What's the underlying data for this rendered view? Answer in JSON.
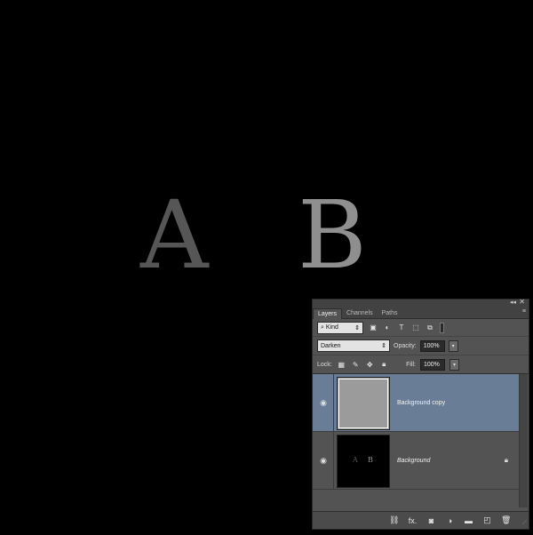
{
  "canvas": {
    "letter_a": "A",
    "letter_b": "B",
    "letter_a_color": "#565656",
    "letter_b_color": "#8f8f8f"
  },
  "panel": {
    "tabs": [
      "Layers",
      "Channels",
      "Paths"
    ],
    "active_tab": "Layers",
    "filter": {
      "kind_label": "Kind",
      "icons": [
        "image-filter-icon",
        "adjustment-filter-icon",
        "type-filter-icon",
        "shape-filter-icon",
        "smart-object-filter-icon"
      ]
    },
    "blend_mode": "Darken",
    "opacity_label": "Opacity:",
    "opacity_value": "100%",
    "lock_label": "Lock:",
    "lock_icons": [
      "lock-transparent-icon",
      "lock-paint-icon",
      "lock-position-icon",
      "lock-all-icon"
    ],
    "fill_label": "Fill:",
    "fill_value": "100%",
    "layers": [
      {
        "name": "Background copy",
        "selected": true,
        "thumb": "solid-gray"
      },
      {
        "name": "Background",
        "selected": false,
        "thumb": "A-B-on-black",
        "locked": true
      }
    ],
    "thumb_letters": {
      "a": "A",
      "b": "B"
    },
    "bottom_icons": [
      "link-layers-icon",
      "fx-icon",
      "add-mask-icon",
      "adjustment-layer-icon",
      "new-group-icon",
      "new-layer-icon",
      "trash-icon"
    ],
    "bottom_fx_label": "fx.",
    "selected_color": "#6a7d96"
  }
}
